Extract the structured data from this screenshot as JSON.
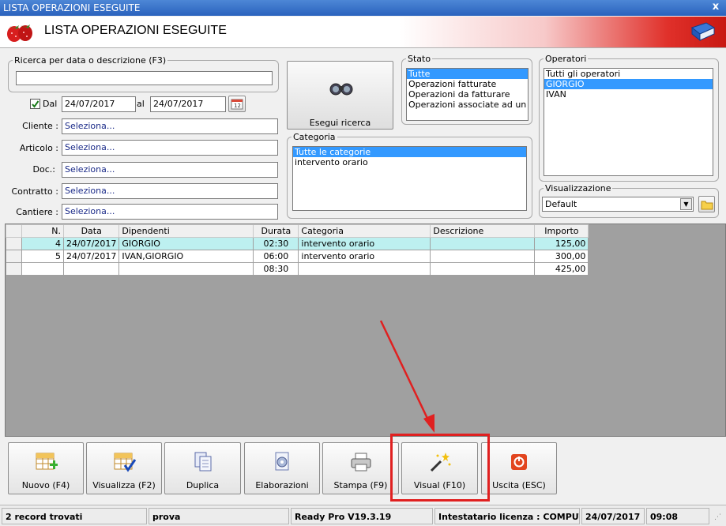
{
  "window": {
    "title": "LISTA OPERAZIONI ESEGUITE",
    "close": "x"
  },
  "header": {
    "title": "LISTA OPERAZIONI ESEGUITE"
  },
  "search": {
    "group_label": "Ricerca per data o descrizione (F3)",
    "text_value": "",
    "dal_label": "Dal",
    "dal_checked": true,
    "date_from": "24/07/2017",
    "al_label": "al",
    "date_to": "24/07/2017",
    "fields": [
      {
        "label": "Cliente :",
        "value": "Seleziona..."
      },
      {
        "label": "Articolo :",
        "value": "Seleziona..."
      },
      {
        "label": "Doc.:",
        "value": "Seleziona..."
      },
      {
        "label": "Contratto :",
        "value": "Seleziona..."
      },
      {
        "label": "Cantiere :",
        "value": "Seleziona..."
      }
    ],
    "search_button": "Esegui ricerca"
  },
  "stato": {
    "label": "Stato",
    "items": [
      "Tutte",
      "Operazioni fatturate",
      "Operazioni da fatturare",
      "Operazioni associate ad un clier"
    ],
    "selected_index": 0
  },
  "categoria": {
    "label": "Categoria",
    "items": [
      "Tutte le categorie",
      "intervento orario"
    ],
    "selected_index": 0
  },
  "operatori": {
    "label": "Operatori",
    "items": [
      "Tutti gli operatori",
      "GIORGIO",
      "IVAN"
    ],
    "selected_index": 1
  },
  "visualizzazione": {
    "label": "Visualizzazione",
    "value": "Default"
  },
  "grid": {
    "headers": [
      "N.",
      "Data",
      "Dipendenti",
      "Durata",
      "Categoria",
      "Descrizione",
      "Importo"
    ],
    "rows": [
      {
        "n": "4",
        "data": "24/07/2017",
        "dipendenti": "GIORGIO",
        "durata": "02:30",
        "categoria": "intervento orario",
        "descrizione": "",
        "importo": "125,00"
      },
      {
        "n": "5",
        "data": "24/07/2017",
        "dipendenti": "IVAN,GIORGIO",
        "durata": "06:00",
        "categoria": "intervento orario",
        "descrizione": "",
        "importo": "300,00"
      }
    ],
    "totals": {
      "durata": "08:30",
      "importo": "425,00"
    }
  },
  "toolbar": {
    "nuovo": "Nuovo (F4)",
    "visualizza": "Visualizza (F2)",
    "duplica": "Duplica",
    "elaborazioni": "Elaborazioni",
    "stampa": "Stampa (F9)",
    "visual": "Visual (F10)",
    "uscita": "Uscita (ESC)"
  },
  "status": {
    "records": "2 record trovati",
    "user": "prova",
    "version": "Ready Pro V19.3.19",
    "license": "Intestatario licenza : COMPUTEF",
    "date": "24/07/2017",
    "time": "09:08"
  },
  "colors": {
    "accent_red": "#e02020",
    "selection_blue": "#3399ff",
    "row_highlight": "#bdf0f0",
    "titlebar": "#2a62bd"
  }
}
